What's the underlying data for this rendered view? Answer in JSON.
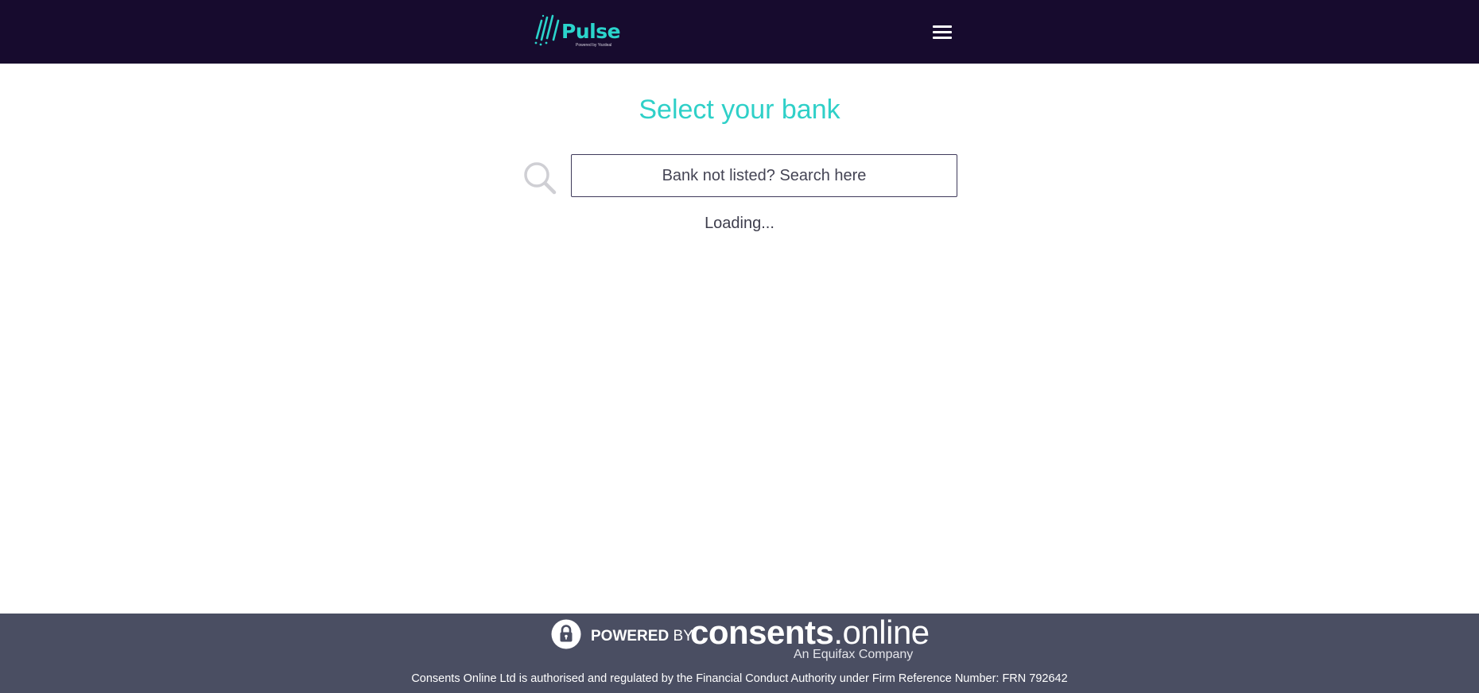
{
  "header": {
    "logo": {
      "name": "Pulse",
      "tagline": "Powered by Yozdeal",
      "icon": "pulse-slashes-icon"
    },
    "menu_icon": "hamburger-menu-icon"
  },
  "main": {
    "title": "Select your bank",
    "search": {
      "icon": "search-icon",
      "placeholder": "Bank not listed? Search here",
      "value": ""
    },
    "status": "Loading..."
  },
  "footer": {
    "lock_icon": "padlock-icon",
    "powered_by_bold": "POWERED",
    "powered_by_rest": "BY",
    "brand_strong": "consents",
    "brand_light": ".online",
    "brand_subtitle": "An Equifax Company",
    "legal": "Consents Online Ltd is authorised and regulated by the Financial Conduct Authority under Firm Reference Number: FRN 792642"
  },
  "colors": {
    "header_bg": "#170b2e",
    "accent": "#2fd0c8",
    "footer_bg": "#4a4e62",
    "text": "#3d3d4c"
  }
}
